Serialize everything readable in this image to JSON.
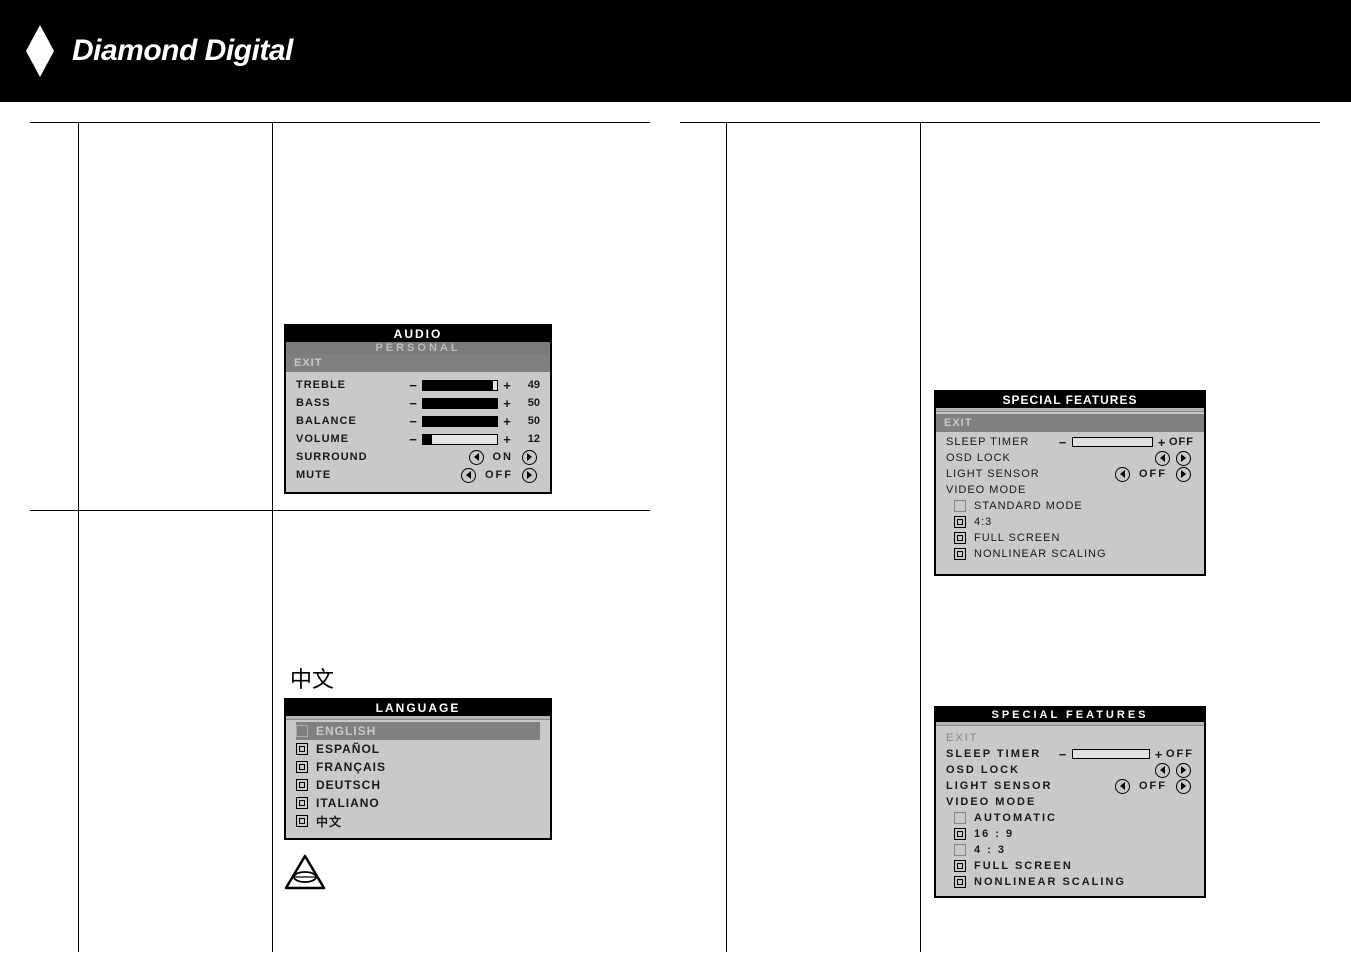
{
  "header": {
    "brand": "Diamond Digital"
  },
  "audio_osd": {
    "title": "AUDIO",
    "subheader": "PERSONAL",
    "exit": "EXIT",
    "rows": [
      {
        "label": "TREBLE",
        "value": 49,
        "fill_pct": 95
      },
      {
        "label": "BASS",
        "value": 50,
        "fill_pct": 100
      },
      {
        "label": "BALANCE",
        "value": 50,
        "fill_pct": 100
      },
      {
        "label": "VOLUME",
        "value": 12,
        "fill_pct": 12
      }
    ],
    "toggles": [
      {
        "label": "SURROUND",
        "state": "ON"
      },
      {
        "label": "MUTE",
        "state": "OFF"
      }
    ]
  },
  "language_osd": {
    "chinese_label": "中文",
    "title": "LANGUAGE",
    "items": [
      {
        "label": "ENGLISH",
        "selected": true
      },
      {
        "label": "ESPAÑOL",
        "selected": false
      },
      {
        "label": "FRANÇAIS",
        "selected": false
      },
      {
        "label": "DEUTSCH",
        "selected": false
      },
      {
        "label": "ITALIANO",
        "selected": false
      },
      {
        "label": "中文",
        "selected": false
      }
    ]
  },
  "special_features_1": {
    "title": "SPECIAL FEATURES",
    "exit": "EXIT",
    "sleep_timer": {
      "label": "SLEEP TIMER",
      "value": "OFF"
    },
    "osd_lock": {
      "label": "OSD LOCK"
    },
    "light_sensor": {
      "label": "LIGHT SENSOR",
      "state": "OFF"
    },
    "video_mode": {
      "label": "VIDEO MODE"
    },
    "modes": [
      {
        "label": "STANDARD MODE",
        "icon": "faded"
      },
      {
        "label": "4:3",
        "icon": "inner"
      },
      {
        "label": "FULL SCREEN",
        "icon": "inner"
      },
      {
        "label": "NONLINEAR SCALING",
        "icon": "inner"
      }
    ]
  },
  "special_features_2": {
    "title": "SPECIAL FEATURES",
    "exit": "EXIT",
    "sleep_timer": {
      "label": "SLEEP TIMER",
      "value": "OFF"
    },
    "osd_lock": {
      "label": "OSD LOCK"
    },
    "light_sensor": {
      "label": "LIGHT SENSOR",
      "state": "OFF"
    },
    "video_mode": {
      "label": "VIDEO MODE"
    },
    "modes": [
      {
        "label": "AUTOMATIC",
        "icon": "faded"
      },
      {
        "label": "16 : 9",
        "icon": "inner"
      },
      {
        "label": "4 : 3",
        "icon": "faded"
      },
      {
        "label": "FULL SCREEN",
        "icon": "inner"
      },
      {
        "label": "NONLINEAR SCALING",
        "icon": "inner"
      }
    ]
  }
}
